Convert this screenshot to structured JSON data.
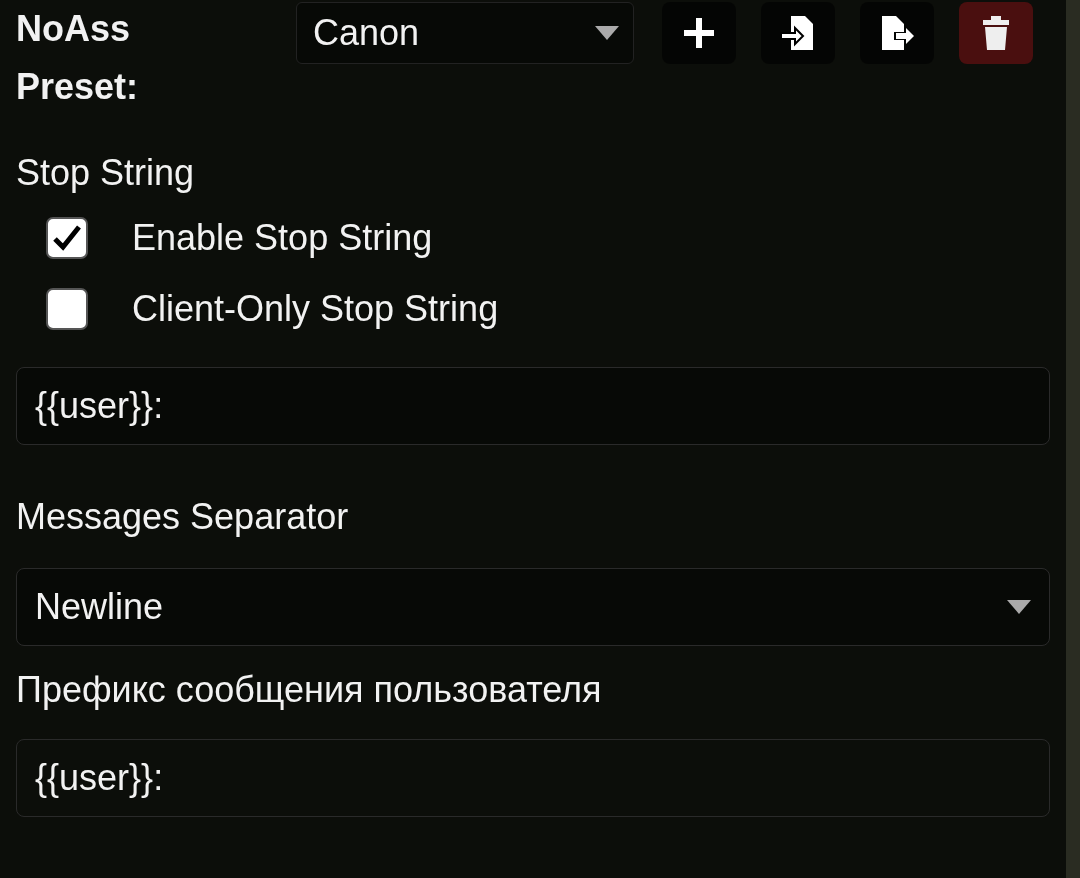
{
  "preset": {
    "label": "NoAss Preset:",
    "value": "Canon"
  },
  "buttons": [
    {
      "kind": "add"
    },
    {
      "kind": "import"
    },
    {
      "kind": "export"
    },
    {
      "kind": "delete"
    }
  ],
  "stop_string": {
    "heading": "Stop String",
    "options": [
      {
        "label": "Enable Stop String",
        "checked": true
      },
      {
        "label": "Client-Only Stop String",
        "checked": false
      }
    ],
    "value": "{{user}}:"
  },
  "separator": {
    "heading": "Messages Separator",
    "value": "Newline"
  },
  "prefix": {
    "heading": "Префикс сообщения пользователя",
    "value": "{{user}}:"
  }
}
